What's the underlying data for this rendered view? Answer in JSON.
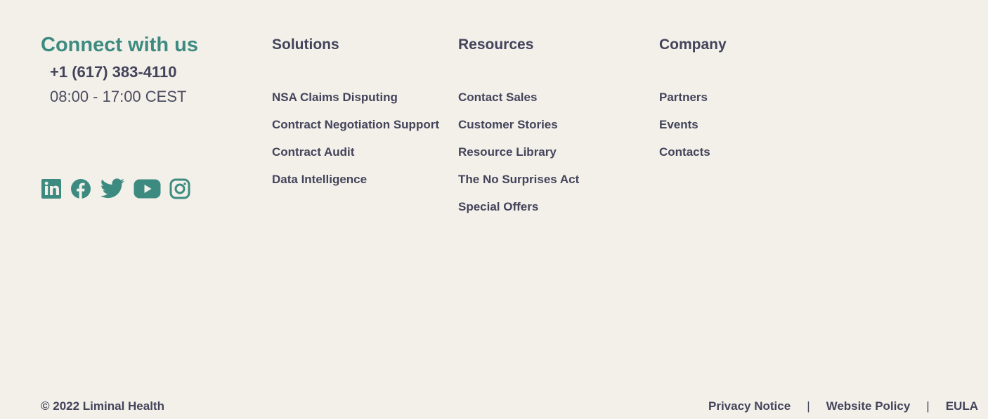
{
  "connect": {
    "title": "Connect with us",
    "phone": "+1 (617) 383-4110",
    "hours": "08:00 - 17:00 CEST"
  },
  "socials": [
    {
      "icon": "linkedin-icon"
    },
    {
      "icon": "facebook-icon"
    },
    {
      "icon": "twitter-icon"
    },
    {
      "icon": "youtube-icon"
    },
    {
      "icon": "instagram-icon"
    }
  ],
  "columns": {
    "solutions": {
      "title": "Solutions",
      "links": [
        "NSA Claims Disputing",
        "Contract Negotiation Support",
        "Contract Audit",
        "Data Intelligence"
      ]
    },
    "resources": {
      "title": "Resources",
      "links": [
        "Contact Sales",
        "Customer Stories",
        "Resource Library",
        "The No Surprises Act",
        "Special Offers"
      ]
    },
    "company": {
      "title": "Company",
      "links": [
        "Partners",
        "Events",
        "Contacts"
      ]
    }
  },
  "bottom": {
    "copyright": "© 2022 Liminal Health",
    "links": [
      "Privacy Notice",
      "Website Policy",
      "EULA"
    ],
    "separator": "|"
  },
  "colors": {
    "background": "#f3f0ea",
    "accent": "#3d8b80",
    "text": "#43445a"
  }
}
